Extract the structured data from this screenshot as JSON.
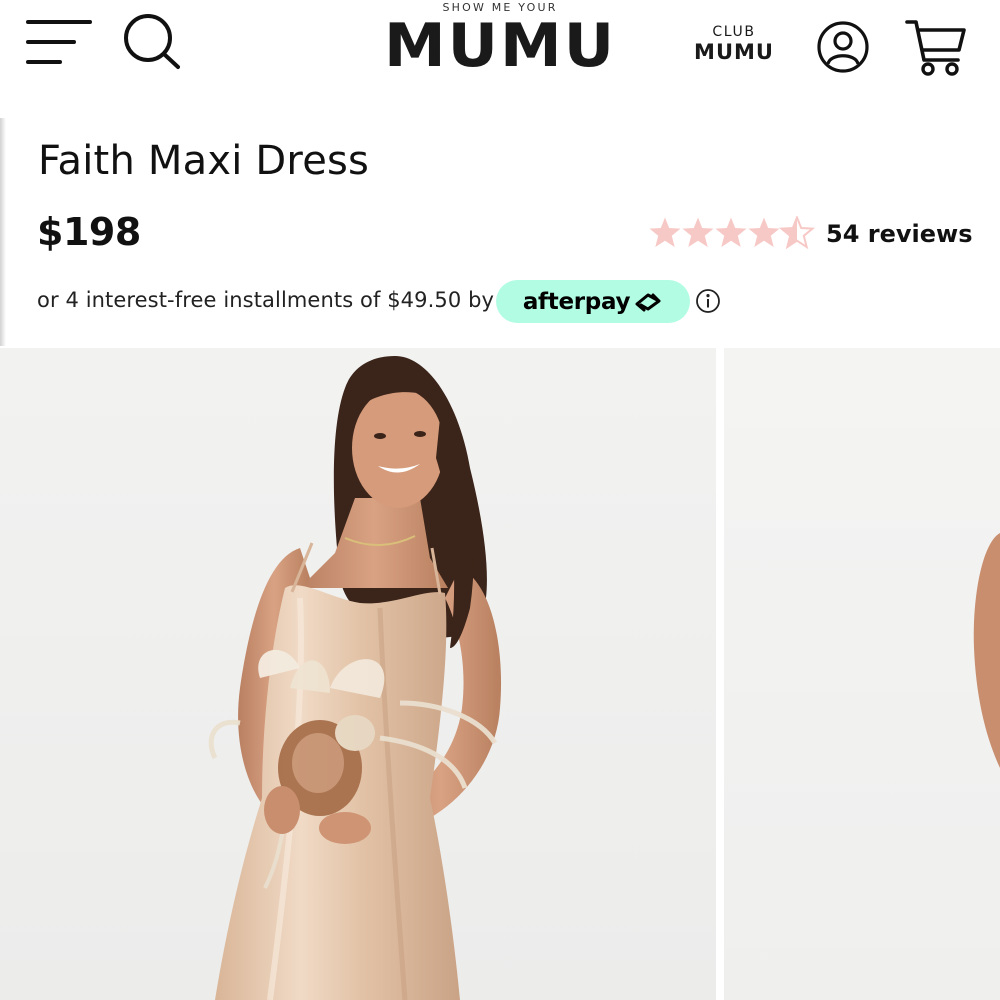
{
  "header": {
    "logo_top": "SHOW ME YOUR",
    "logo_main": "MUMU",
    "club_top": "CLUB",
    "club_bottom": "MUMU",
    "icons": [
      "hamburger-menu-icon",
      "search-icon",
      "user-account-icon",
      "shopping-cart-icon"
    ]
  },
  "product": {
    "title": "Faith Maxi Dress",
    "price": "$198",
    "rating": 4.5,
    "rating_max": 5,
    "reviews_label": "54 reviews",
    "installment_text": "or 4 interest-free installments of $49.50 by",
    "afterpay_label": "afterpay"
  },
  "colors": {
    "star": "#f7c9c6",
    "afterpay_mint": "#b2fce4",
    "text": "#111111",
    "dress": "#e6c8ad"
  },
  "gallery": {
    "images": [
      "model-in-champagne-satin-maxi-dress-holding-dried-bouquet",
      "model-partial-view"
    ]
  }
}
